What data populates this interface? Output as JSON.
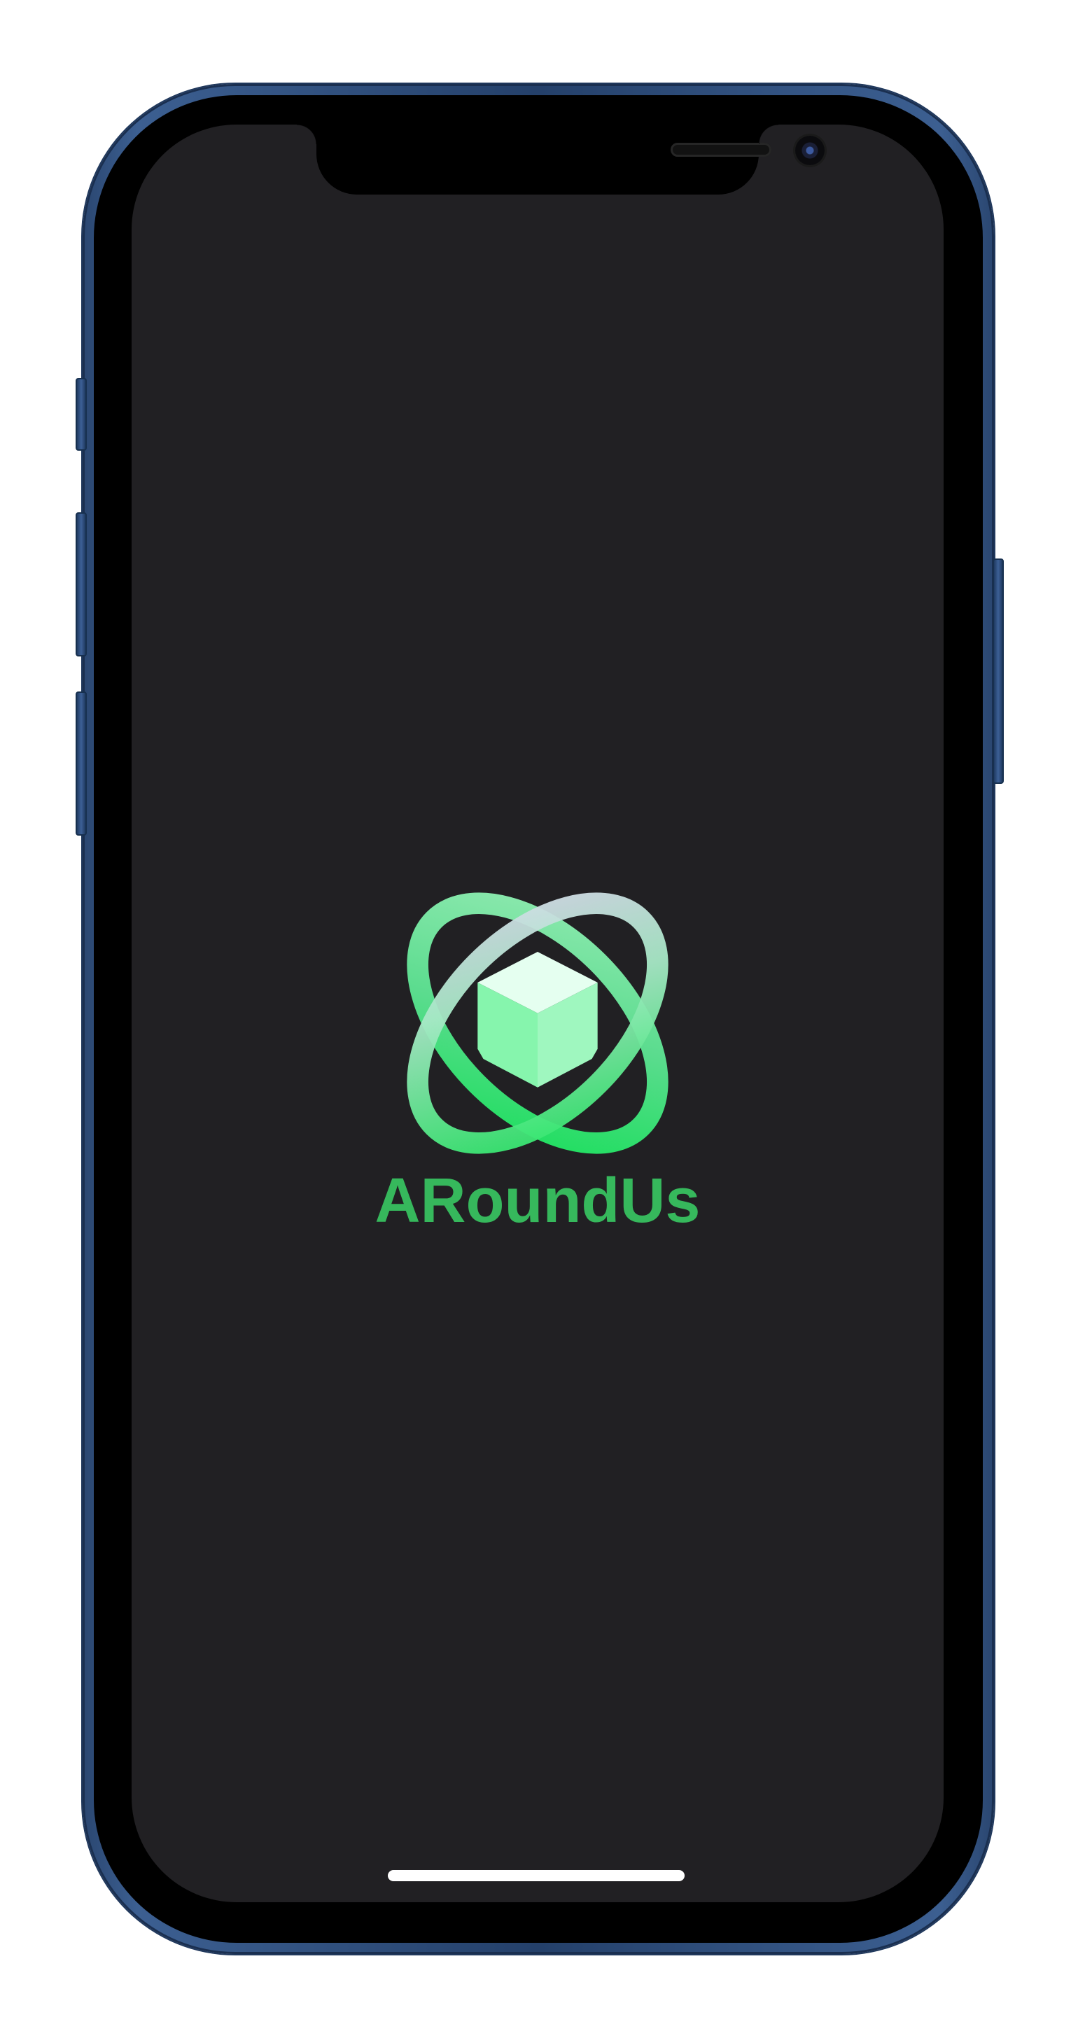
{
  "app": {
    "name": "ARoundUs",
    "name_color": "#36b85c",
    "background_color": "#212023"
  },
  "device": {
    "model": "iPhone",
    "frame_color": "#2f4f7f"
  },
  "logo": {
    "icon": "orbit-cube-logo-icon",
    "colors": [
      "#7df0a4",
      "#1fe85c",
      "#d8d4ea",
      "#e6fff0"
    ]
  }
}
